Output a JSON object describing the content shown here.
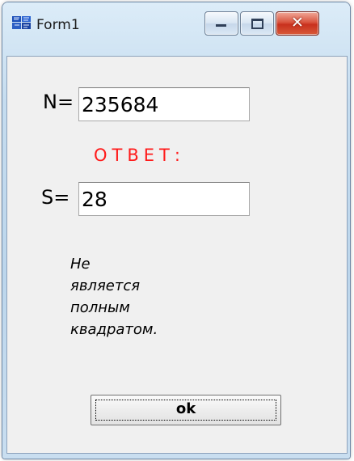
{
  "window": {
    "title": "Form1",
    "icon": "delphi-app-icon",
    "controls": {
      "minimize_icon": "minimize-icon",
      "maximize_icon": "maximize-icon",
      "close_icon": "close-icon",
      "close_glyph": "✕"
    },
    "colors": {
      "close_button": "#c8301d",
      "answer_text": "#ff1a1a"
    }
  },
  "form": {
    "n_label": "N=",
    "n_value": "235684",
    "answer_label": "ОТВЕТ:",
    "s_label": "S=",
    "s_value": "28",
    "message_lines": [
      "Не",
      "является",
      "полным",
      "квадратом."
    ],
    "ok_label": "ok"
  }
}
